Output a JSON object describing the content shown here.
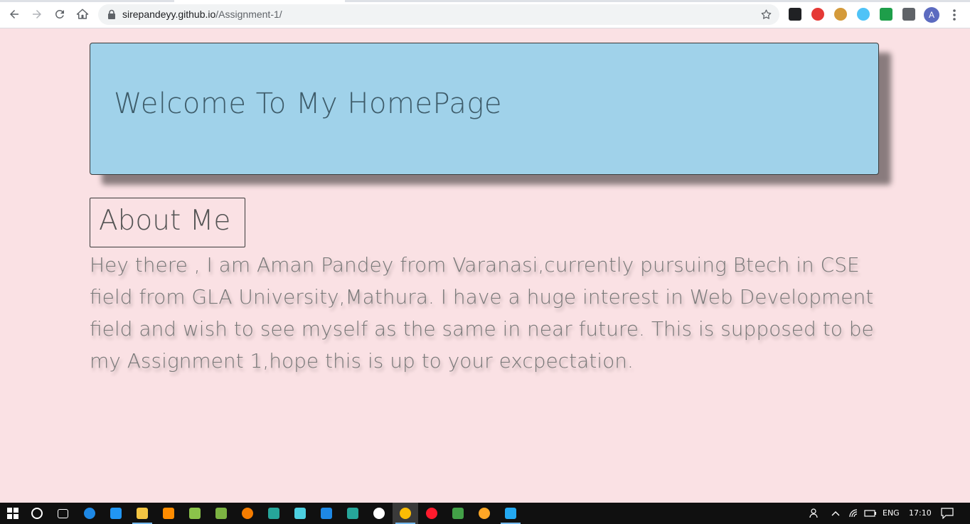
{
  "browser": {
    "url_host": "sirepandeyy.github.io",
    "url_path": "/Assignment-1/",
    "profile_initial": "A",
    "extensions": [
      {
        "name": "ext-dark-icon",
        "color": "#202124"
      },
      {
        "name": "ext-red-hand-icon",
        "color": "#e53935"
      },
      {
        "name": "ext-cookie-icon",
        "color": "#d49a3a"
      },
      {
        "name": "ext-search-icon",
        "color": "#4fc3f7"
      },
      {
        "name": "ext-shield-icon",
        "color": "#1e9e4a"
      },
      {
        "name": "ext-puzzle-icon",
        "color": "#5f6368"
      }
    ]
  },
  "page": {
    "hero_title": "Welcome To My HomePage",
    "about_heading": "About Me",
    "about_text": "Hey there , I am Aman Pandey from Varanasi,currently pursuing Btech in CSE field from GLA University,Mathura. I have a huge interest in Web Development field and wish to see myself as the same in near future. This is supposed to be my Assignment 1,hope this is up to your excpectation.",
    "background_color": "#fae1e4",
    "hero_color": "#a0d2ea"
  },
  "taskbar": {
    "apps": [
      {
        "name": "start-icon",
        "color": "#ffffff"
      },
      {
        "name": "search-icon",
        "color": "#ffffff"
      },
      {
        "name": "task-view-icon",
        "color": "#ffffff"
      },
      {
        "name": "edge-icon",
        "color": "#1e88e5"
      },
      {
        "name": "mail-icon",
        "color": "#2196f3"
      },
      {
        "name": "file-explorer-icon",
        "color": "#f4c542"
      },
      {
        "name": "vlc-icon",
        "color": "#ff8c00"
      },
      {
        "name": "app-green-icon",
        "color": "#8bc34a"
      },
      {
        "name": "app-stack-icon",
        "color": "#7cb342"
      },
      {
        "name": "blender-icon",
        "color": "#f57c00"
      },
      {
        "name": "app-a-icon",
        "color": "#26a69a"
      },
      {
        "name": "app-m-icon",
        "color": "#4dd0e1"
      },
      {
        "name": "teamviewer-icon",
        "color": "#1e88e5"
      },
      {
        "name": "app-terminal-icon",
        "color": "#26a69a"
      },
      {
        "name": "maps-icon",
        "color": "#ffffff"
      },
      {
        "name": "chrome-icon",
        "color": "#fbbc05"
      },
      {
        "name": "opera-icon",
        "color": "#ff1b2d"
      },
      {
        "name": "app-chrome-alt-icon",
        "color": "#43a047"
      },
      {
        "name": "app-orange-icon",
        "color": "#ffa726"
      },
      {
        "name": "vscode-icon",
        "color": "#23a9f2"
      }
    ],
    "language": "ENG",
    "time": "17:10"
  }
}
